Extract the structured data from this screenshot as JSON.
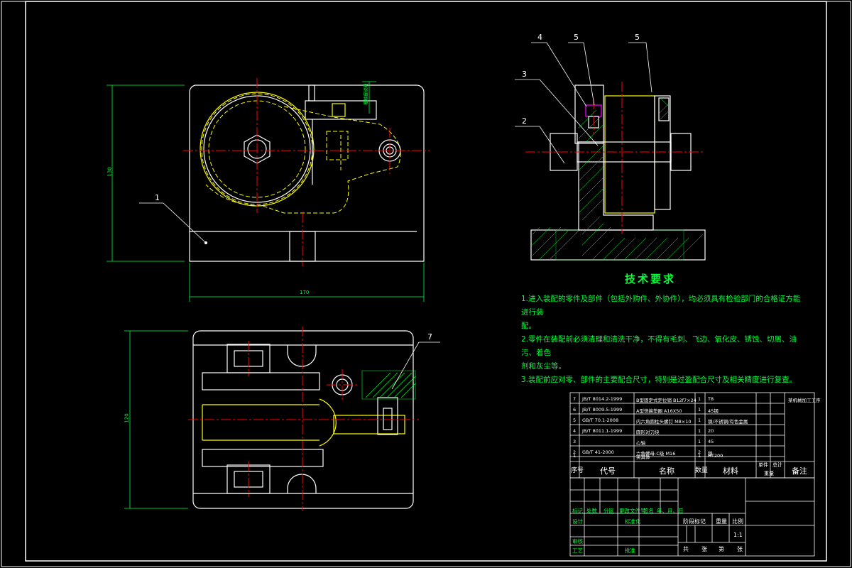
{
  "balloons": {
    "b1": "1",
    "b1b": "7",
    "b2": "2",
    "b3": "3",
    "b4": "4",
    "b5a": "5",
    "b5b": "5"
  },
  "dims": {
    "top_height": "130",
    "top_width": "170",
    "bottom_height": "120",
    "side_note": "粗糙度说明"
  },
  "requirements": {
    "title": "技术要求",
    "line1a": "1.进入装配的零件及部件（包括外购件、外协件），均必须具有检验部门的合格证方能进行装",
    "line1b": "配。",
    "line2a": "2.零件在装配前必须清理和清洗干净，不得有毛刺、飞边、氧化皮、锈蚀、切屑、油污、着色",
    "line2b": "剂和灰尘等。",
    "line3": "3.装配前应对零、部件的主要配合尺寸，特别是过盈配合尺寸及相关精度进行复查。"
  },
  "bom": {
    "rows": [
      {
        "no": "7",
        "code": "JB/T 8014.2-1999",
        "name": "B型固定式定位销 B12f7×24",
        "qty": "1",
        "mat": "T8"
      },
      {
        "no": "6",
        "code": "JB/T 8009.5-1999",
        "name": "A型快换垫圈 A16X50",
        "qty": "1",
        "mat": "45钢"
      },
      {
        "no": "5",
        "code": "GB/T 70.1-2008",
        "name": "内六角圆柱头螺钉 M8×10",
        "qty": "1",
        "mat": "钢/不锈钢/有色金属"
      },
      {
        "no": "4",
        "code": "JB/T 8011.1-1999",
        "name": "圆形对刀块",
        "qty": "1",
        "mat": "20"
      },
      {
        "no": "3",
        "code": "",
        "name": "心轴",
        "qty": "1",
        "mat": "45"
      },
      {
        "no": "2",
        "code": "GB/T 41-2000",
        "name": "六角螺母-C级 M16",
        "qty": "2",
        "mat": "钢"
      },
      {
        "no": "1",
        "code": "",
        "name": "夹具体",
        "qty": "1",
        "mat": "HT200"
      }
    ],
    "header": {
      "no": "序号",
      "code": "代号",
      "name": "名称",
      "qty": "数量",
      "mat": "材料",
      "unit": "单件",
      "total": "总计",
      "weight": "重量",
      "remark": "备注"
    },
    "corner": "某机械加工工序"
  },
  "titleblock": {
    "mark": "标记",
    "count": "处数",
    "zone": "分区",
    "doc": "更改文件号",
    "sign": "签名",
    "date": "年、月、日",
    "design": "设计",
    "std": "标准化",
    "stage": "阶段标记",
    "weight": "重量",
    "scale": "比例",
    "scale_val": "1:1",
    "review": "审核",
    "craft": "工艺",
    "approve": "批准",
    "sheets": "共",
    "sheet_of": "张",
    "page": "第",
    "page_of": "张"
  },
  "colors": {
    "outline": "#ffffff",
    "center": "#ff0000",
    "hidden": "#ffff00",
    "dimension": "#00ff3c",
    "hatch": "#00ff3c",
    "accent": "#ff00ff",
    "text": "#00ff3c"
  }
}
